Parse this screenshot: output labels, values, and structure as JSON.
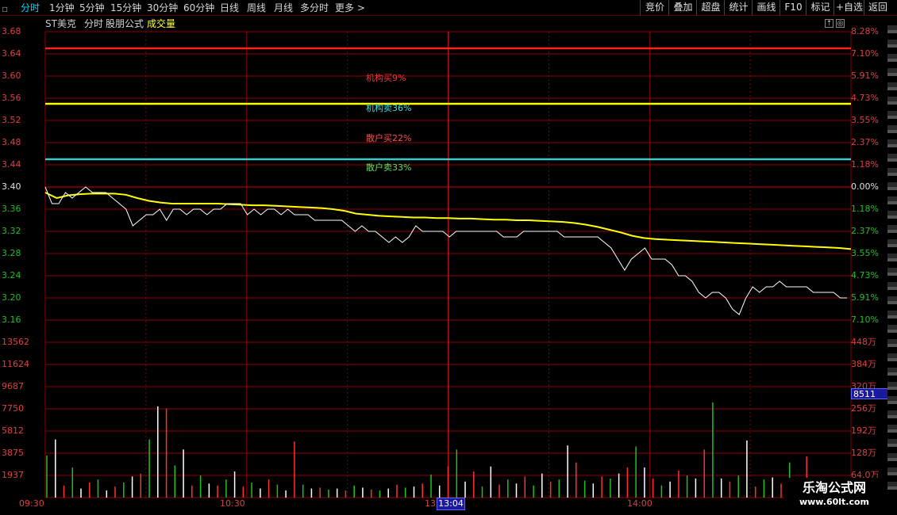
{
  "toolbar": {
    "left_tabs": [
      "分时",
      "1分钟",
      "5分钟",
      "15分钟",
      "30分钟",
      "60分钟",
      "日线",
      "周线",
      "月线",
      "多分时",
      "更多 >"
    ],
    "right_buttons": [
      "竞价",
      "叠加",
      "超盘",
      "统计",
      "画线",
      "F10",
      "标记",
      "+自选",
      "返回"
    ]
  },
  "header": {
    "stock": "ST美克",
    "mode": "分时",
    "formula": "股朋公式",
    "indicator": "成交量"
  },
  "price_axis": {
    "left": [
      "3.68",
      "3.64",
      "3.60",
      "3.56",
      "3.52",
      "3.48",
      "3.44",
      "3.40",
      "3.36",
      "3.32",
      "3.28",
      "3.24",
      "3.20",
      "3.16"
    ],
    "right": [
      "8.28%",
      "7.10%",
      "5.91%",
      "4.73%",
      "3.55%",
      "2.37%",
      "1.18%",
      "0.00%",
      "1.18%",
      "2.37%",
      "3.55%",
      "4.73%",
      "5.91%",
      "7.10%"
    ]
  },
  "volume_axis": {
    "left": [
      "13562",
      "11624",
      "9687",
      "7750",
      "5812",
      "3875",
      "1937"
    ],
    "right": [
      "448万",
      "384万",
      "320万",
      "256万",
      "192万",
      "128万",
      "64.0万"
    ],
    "cursor_value": "8511"
  },
  "annotations": [
    {
      "text": "机构买9%",
      "color": "#ff3030"
    },
    {
      "text": "机构卖36%",
      "color": "#40e0e0"
    },
    {
      "text": "散户买22%",
      "color": "#ff5050"
    },
    {
      "text": "散户卖33%",
      "color": "#60e060"
    }
  ],
  "time_axis": {
    "labels": [
      "09:30",
      "10:30",
      "13",
      "14:00"
    ],
    "cursor_time": "13:04"
  },
  "watermark": {
    "name": "乐淘公式网",
    "url": "www.60lt.com"
  },
  "colors": {
    "grid": "#8b0000",
    "red_line": "#ff2020",
    "yellow": "#ffff00",
    "cyan": "#40c8c8",
    "price": "#ffffff",
    "avg": "#ffff00",
    "vol_up": "#ff3030",
    "vol_down": "#20c020",
    "vol_flat": "#ffffff"
  },
  "chart_data": {
    "type": "line",
    "price_range": [
      3.16,
      3.68
    ],
    "reference_lines": [
      3.65,
      3.55,
      3.45
    ],
    "price": [
      3.4,
      3.37,
      3.37,
      3.39,
      3.38,
      3.39,
      3.4,
      3.39,
      3.39,
      3.39,
      3.38,
      3.37,
      3.36,
      3.33,
      3.34,
      3.35,
      3.35,
      3.36,
      3.34,
      3.36,
      3.36,
      3.35,
      3.36,
      3.36,
      3.35,
      3.36,
      3.36,
      3.37,
      3.37,
      3.37,
      3.35,
      3.36,
      3.35,
      3.36,
      3.36,
      3.35,
      3.36,
      3.35,
      3.35,
      3.35,
      3.34,
      3.34,
      3.34,
      3.34,
      3.34,
      3.33,
      3.32,
      3.33,
      3.32,
      3.32,
      3.31,
      3.3,
      3.31,
      3.3,
      3.31,
      3.33,
      3.32,
      3.32,
      3.32,
      3.32,
      3.31,
      3.32,
      3.32,
      3.32,
      3.32,
      3.32,
      3.32,
      3.32,
      3.31,
      3.31,
      3.31,
      3.32,
      3.32,
      3.32,
      3.32,
      3.32,
      3.32,
      3.31,
      3.31,
      3.31,
      3.31,
      3.31,
      3.31,
      3.3,
      3.29,
      3.27,
      3.25,
      3.27,
      3.28,
      3.29,
      3.27,
      3.27,
      3.27,
      3.26,
      3.24,
      3.24,
      3.23,
      3.21,
      3.2,
      3.21,
      3.21,
      3.2,
      3.18,
      3.17,
      3.2,
      3.22,
      3.21,
      3.22,
      3.22,
      3.23,
      3.22,
      3.22,
      3.22,
      3.22,
      3.21,
      3.21,
      3.21,
      3.21,
      3.2,
      3.2
    ],
    "avg": [
      3.39,
      3.38,
      3.385,
      3.387,
      3.388,
      3.388,
      3.388,
      3.386,
      3.38,
      3.375,
      3.372,
      3.37,
      3.37,
      3.37,
      3.37,
      3.37,
      3.369,
      3.368,
      3.367,
      3.367,
      3.366,
      3.365,
      3.364,
      3.363,
      3.362,
      3.36,
      3.357,
      3.352,
      3.35,
      3.348,
      3.347,
      3.346,
      3.345,
      3.345,
      3.344,
      3.344,
      3.343,
      3.343,
      3.342,
      3.341,
      3.341,
      3.34,
      3.34,
      3.339,
      3.338,
      3.337,
      3.335,
      3.332,
      3.328,
      3.323,
      3.318,
      3.312,
      3.308,
      3.306,
      3.305,
      3.304,
      3.303,
      3.302,
      3.301,
      3.3,
      3.299,
      3.298,
      3.297,
      3.296,
      3.295,
      3.294,
      3.293,
      3.292,
      3.291,
      3.29,
      3.288
    ],
    "volume_range": [
      0,
      15500
    ],
    "volume": [
      4200,
      5800,
      1200,
      3000,
      900,
      1500,
      1800,
      700,
      1100,
      1500,
      2100,
      2400,
      5800,
      9100,
      8900,
      3200,
      4800,
      1200,
      2200,
      1400,
      1200,
      1800,
      2600,
      1100,
      1500,
      900,
      1800,
      1300,
      700,
      5600,
      1300,
      900,
      1000,
      800,
      900,
      700,
      1200,
      1000,
      800,
      700,
      900,
      1300,
      1000,
      1100,
      1400,
      2300,
      1200,
      3100,
      4800,
      1600,
      2600,
      1100,
      3100,
      1300,
      1800,
      1400,
      2100,
      1200,
      2400,
      1600,
      1800,
      5200,
      3500,
      1700,
      1400,
      2100,
      1900,
      2400,
      3000,
      5100,
      3000,
      1900,
      1200,
      1600,
      2700,
      2200,
      1900,
      4800,
      9500,
      1900,
      1600,
      2200,
      5700,
      1100,
      1800,
      2000,
      1400,
      3500,
      1100,
      4100,
      1500,
      1900,
      1500,
      1800
    ]
  }
}
